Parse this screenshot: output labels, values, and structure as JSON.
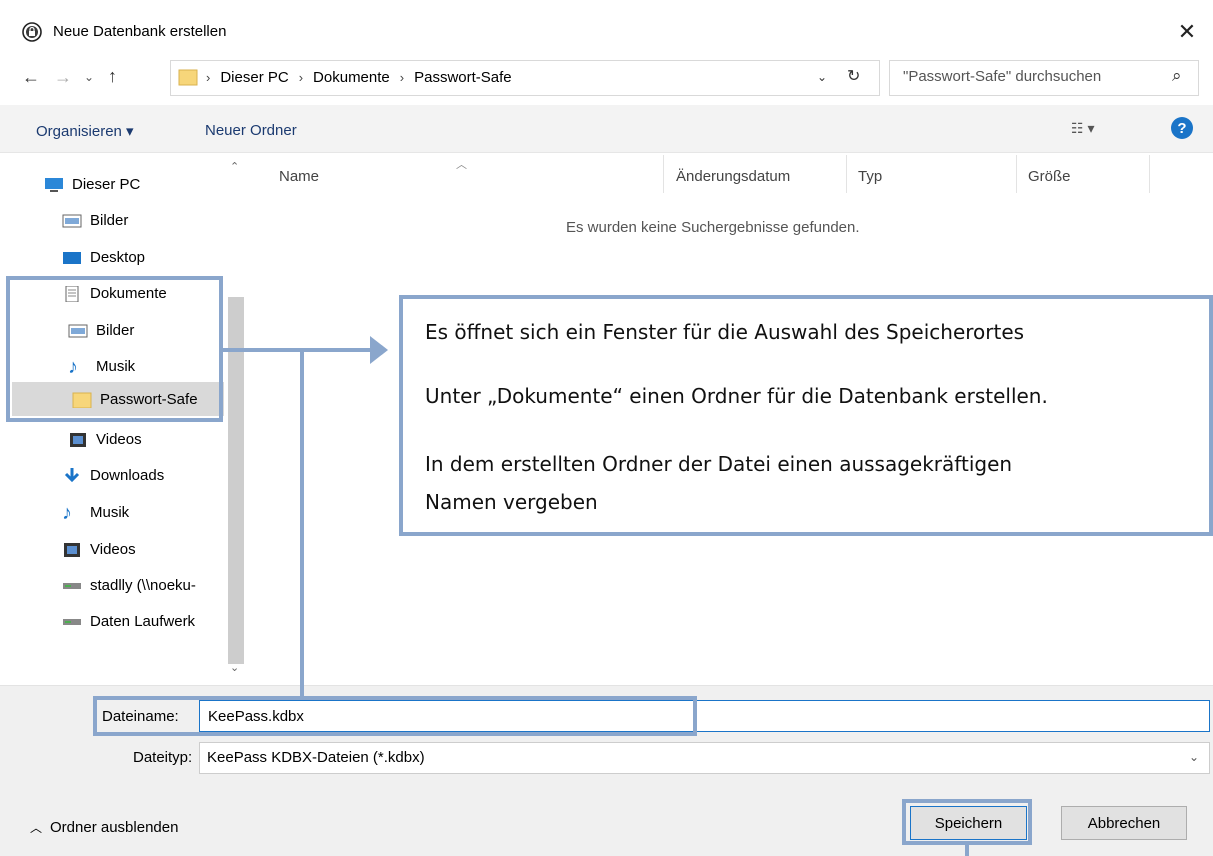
{
  "window": {
    "title": "Neue Datenbank erstellen"
  },
  "address": {
    "crumbs": [
      "Dieser PC",
      "Dokumente",
      "Passwort-Safe"
    ],
    "search_placeholder": "\"Passwort-Safe\" durchsuchen"
  },
  "toolbar": {
    "organize_label": "Organisieren ▾",
    "new_folder_label": "Neuer Ordner",
    "help_label": "?"
  },
  "nav": {
    "items": [
      {
        "label": "Dieser PC",
        "icon": "computer-icon"
      },
      {
        "label": "Bilder",
        "icon": "pictures-icon"
      },
      {
        "label": "Desktop",
        "icon": "desktop-icon"
      },
      {
        "label": "Dokumente",
        "icon": "documents-icon"
      },
      {
        "label": "Bilder",
        "icon": "pictures-icon"
      },
      {
        "label": "Musik",
        "icon": "music-icon"
      },
      {
        "label": "Passwort-Safe",
        "icon": "folder-icon"
      },
      {
        "label": "Videos",
        "icon": "videos-icon"
      },
      {
        "label": "Downloads",
        "icon": "downloads-icon"
      },
      {
        "label": "Musik",
        "icon": "music-icon"
      },
      {
        "label": "Videos",
        "icon": "videos-icon"
      },
      {
        "label": "stadlly (\\\\noeku-",
        "icon": "network-drive-icon"
      },
      {
        "label": "Daten Laufwerk",
        "icon": "network-drive-icon"
      }
    ]
  },
  "file_list": {
    "columns": [
      "Name",
      "Änderungsdatum",
      "Typ",
      "Größe"
    ],
    "empty_message": "Es wurden keine Suchergebnisse gefunden."
  },
  "form": {
    "filename_label": "Dateiname:",
    "filename_value": "KeePass.kdbx",
    "filetype_label": "Dateityp:",
    "filetype_value": "KeePass KDBX-Dateien (*.kdbx)"
  },
  "footer": {
    "hide_folders_label": "Ordner ausblenden",
    "save_label": "Speichern",
    "cancel_label": "Abbrechen"
  },
  "callout": {
    "line1": "Es öffnet sich ein Fenster für die Auswahl des Speicherortes",
    "line2": "Unter „Dokumente“ einen Ordner für die Datenbank erstellen.",
    "line3a": "In dem erstellten Ordner der Datei einen aussagekräftigen",
    "line3b": "Namen vergeben"
  },
  "colors": {
    "accent": "#1a74c8",
    "callout_border": "#8aa6cc",
    "selection": "#d9d9d9"
  }
}
